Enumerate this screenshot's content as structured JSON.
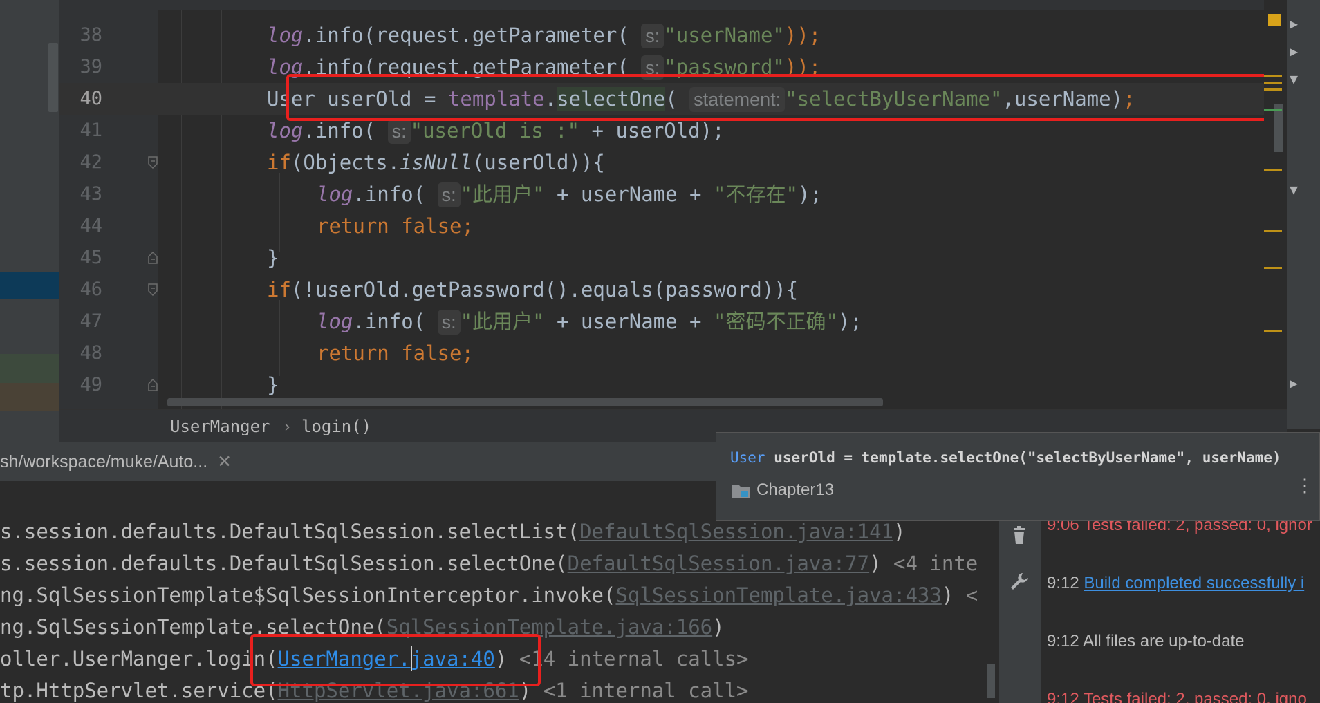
{
  "editor": {
    "lines": [
      {
        "num": "38"
      },
      {
        "num": "39"
      },
      {
        "num": "40"
      },
      {
        "num": "41"
      },
      {
        "num": "42"
      },
      {
        "num": "43"
      },
      {
        "num": "44"
      },
      {
        "num": "45"
      },
      {
        "num": "46"
      },
      {
        "num": "47"
      },
      {
        "num": "48"
      },
      {
        "num": "49"
      }
    ],
    "code": {
      "l38": {
        "a": "log",
        "b": ".info(request.getParameter( ",
        "hint": "s:",
        "c": "\"userName\"",
        "d": "));"
      },
      "l39": {
        "a": "log",
        "b": ".info(request.getParameter( ",
        "hint": "s:",
        "c": "\"password\"",
        "d": "));"
      },
      "l40": {
        "a": "User userOld = ",
        "b": "template",
        "c": ".",
        "d": "selectOne",
        "e": "( ",
        "hint": "statement:",
        "f": "\"selectByUserName\"",
        "g": ",userName)",
        "h": ";"
      },
      "l41": {
        "a": "log",
        "b": ".info( ",
        "hint": "s:",
        "c": "\"userOld is :\"",
        "d": " + userOld);"
      },
      "l42": {
        "a": "if",
        "b": "(Objects.",
        "c": "isNull",
        "d": "(userOld)){"
      },
      "l43": {
        "a": "log",
        "b": ".info( ",
        "hint": "s:",
        "c": "\"此用户\"",
        "d": " + userName + ",
        "e": "\"不存在\"",
        "f": ");"
      },
      "l44": {
        "a": "return false",
        "b": ";"
      },
      "l45": {
        "a": "}"
      },
      "l46": {
        "a": "if",
        "b": "(!userOld.getPassword().equals(password)){"
      },
      "l47": {
        "a": "log",
        "b": ".info( ",
        "hint": "s:",
        "c": "\"此用户\"",
        "d": " + userName + ",
        "e": "\"密码不正确\"",
        "f": ");"
      },
      "l48": {
        "a": "return false",
        "b": ";"
      },
      "l49": {
        "a": "}"
      }
    }
  },
  "breadcrumb": {
    "class_name": "UserManger",
    "separator": "›",
    "method": "login()"
  },
  "run_tab": {
    "title": "sh/workspace/muke/Auto...",
    "close": "✕"
  },
  "console": {
    "l1": {
      "a": "s.session.defaults.DefaultSqlSession.selectList(",
      "link": "DefaultSqlSession.java:141",
      "b": ")"
    },
    "l2": {
      "a": "s.session.defaults.DefaultSqlSession.selectOne(",
      "link": "DefaultSqlSession.java:77",
      "b": ")",
      "c": " <4 inte"
    },
    "l3": {
      "a": "ng.SqlSessionTemplate$SqlSessionInterceptor.invoke(",
      "link": "SqlSessionTemplate.java:433",
      "b": ")",
      "c": " <"
    },
    "l4": {
      "a": "ng.SqlSessionTemplate.selectOne(",
      "link": "SqlSessionTemplate.java:166",
      "b": ")"
    },
    "l5": {
      "a": "oller.UserManger.login(",
      "link": "UserManger.java:40",
      "b": ")",
      "c": " <14 internal calls>"
    },
    "l6": {
      "a": "tp.HttpServlet.service(",
      "link": "HttpServlet.java:661",
      "b": ")",
      "c": " <1 internal call>"
    }
  },
  "popup": {
    "sig_type": "User",
    "sig_rest": " userOld = template.selectOne(\"selectByUserName\", userName)",
    "context": "Chapter13",
    "more": "⋮"
  },
  "event_log": {
    "e1": {
      "time": "9:06",
      "text": "Tests failed: 2, passed: 0, ignor"
    },
    "e2": {
      "time": "9:12",
      "text": "Build completed successfully i"
    },
    "e3": {
      "time": "9:12",
      "text": "All files are up-to-date"
    },
    "e4": {
      "time": "9:12",
      "text": "Tests failed: 2, passed: 0, igno"
    }
  },
  "colors": {
    "highlight_box": "#e8201e",
    "background": "#2b2b2b",
    "keyword": "#cc7832",
    "string": "#6a8759",
    "field": "#9876aa"
  }
}
